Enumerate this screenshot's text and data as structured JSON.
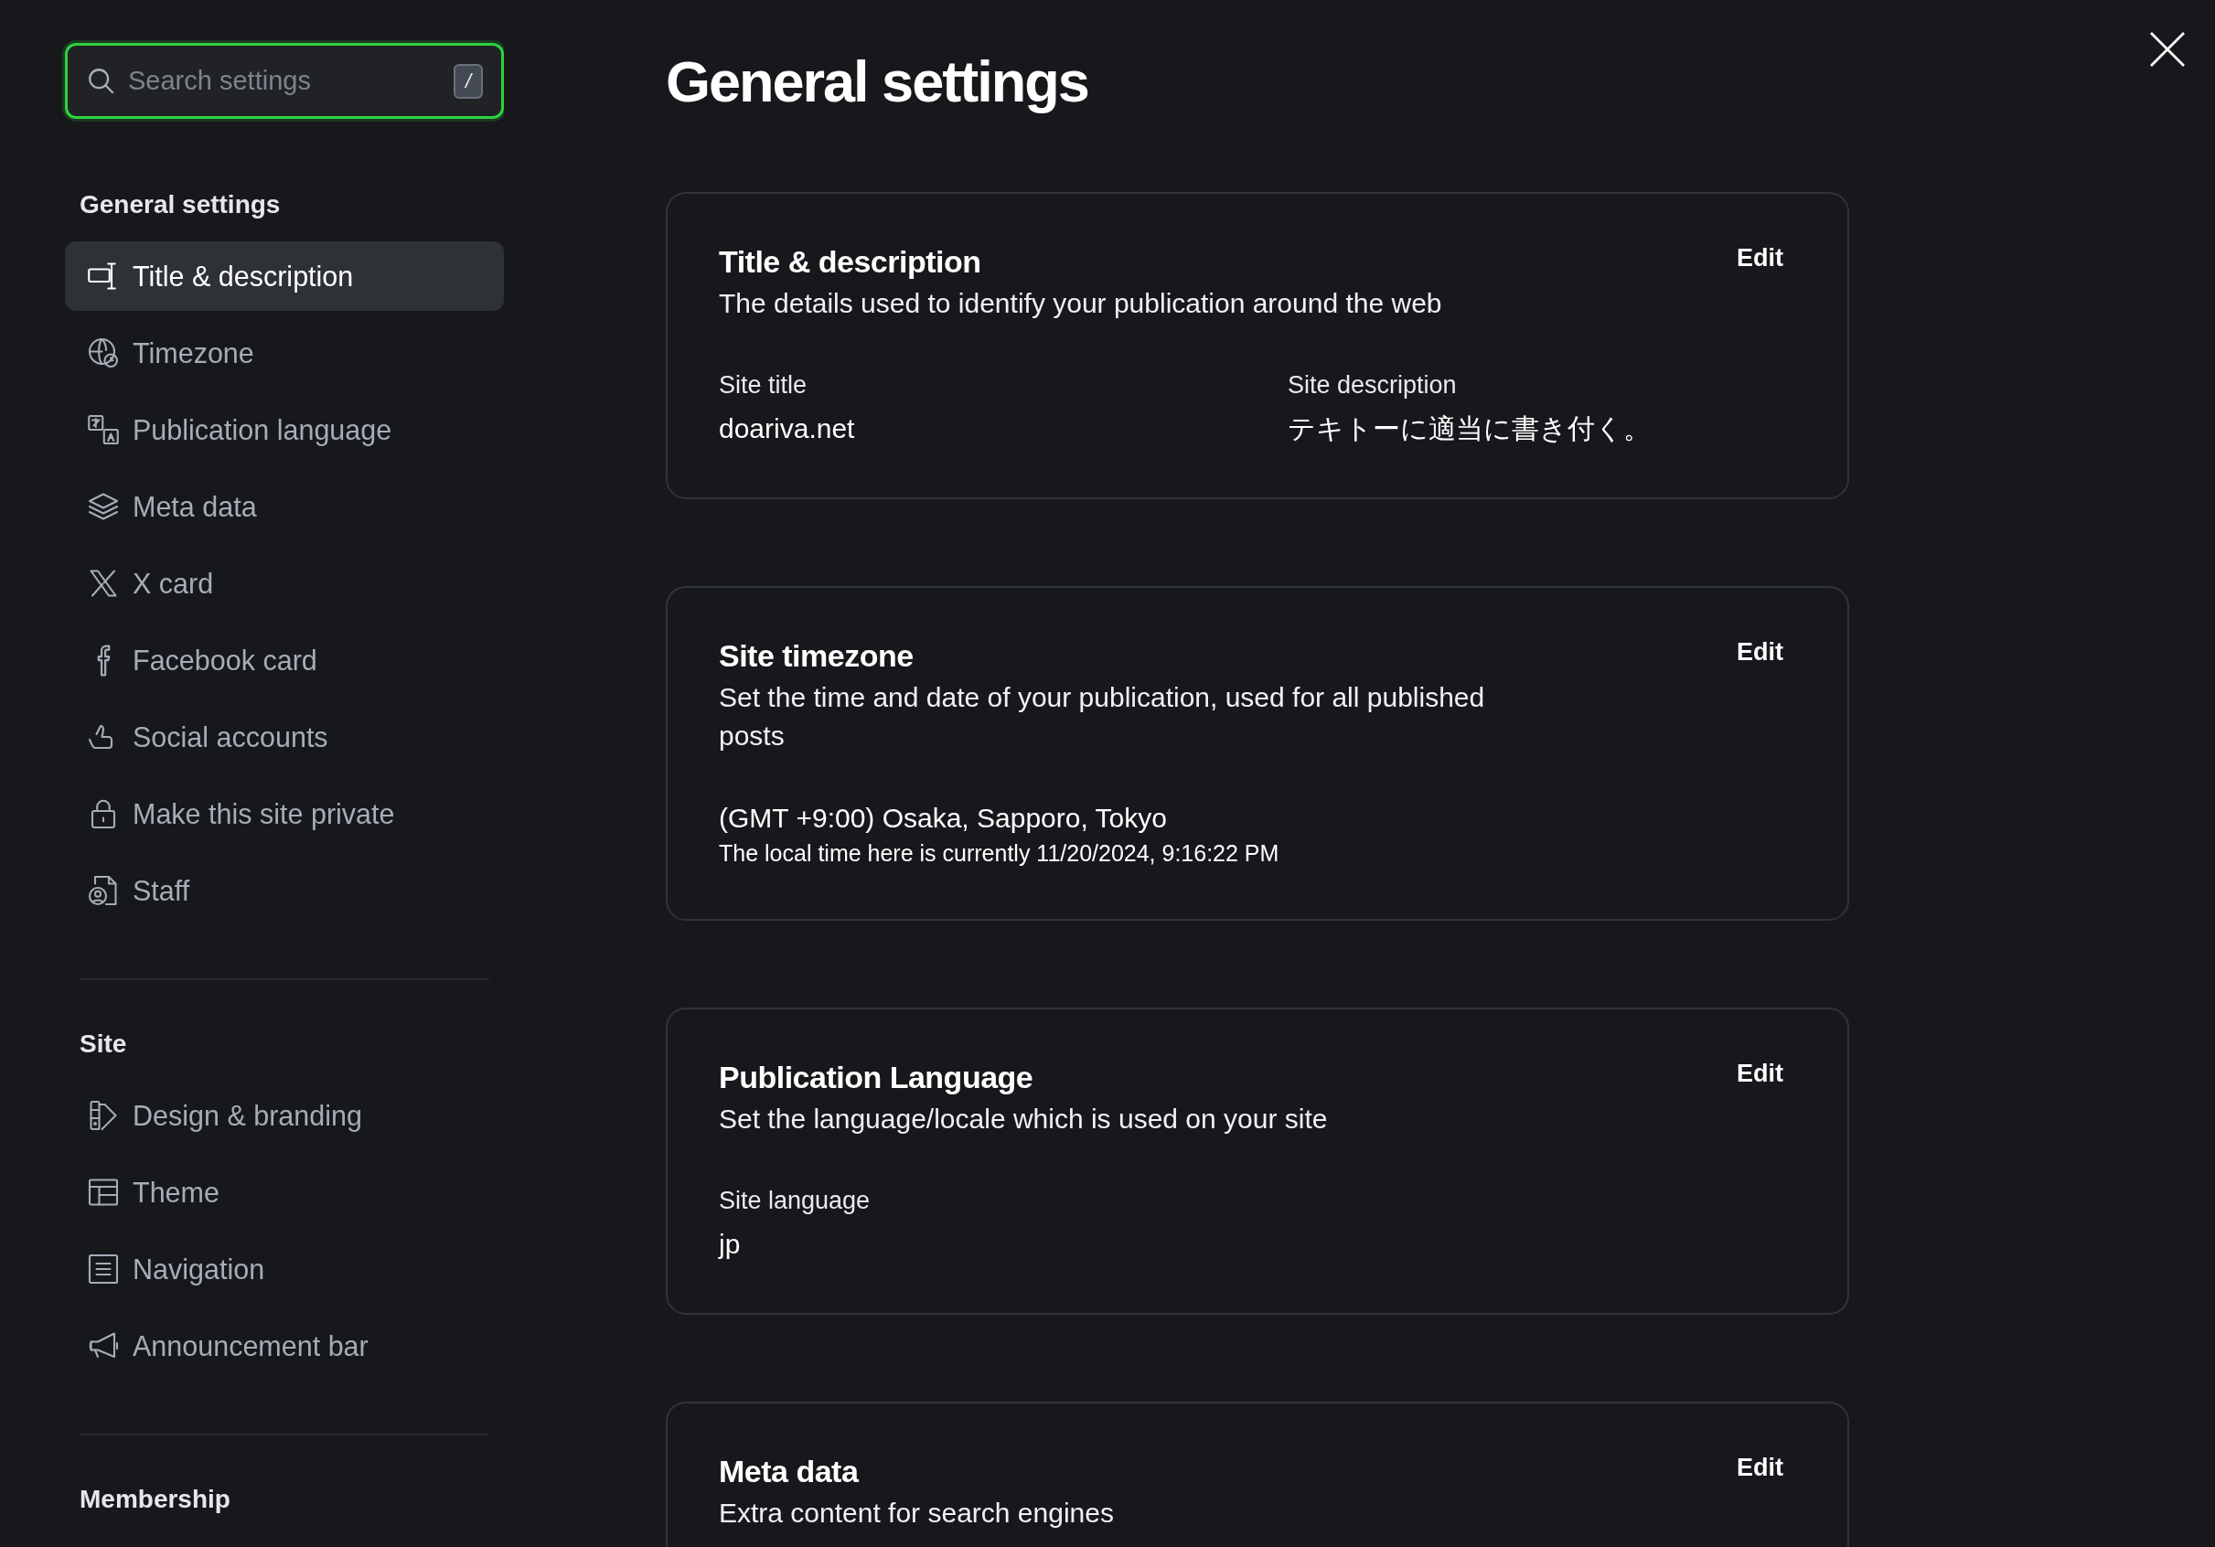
{
  "search": {
    "placeholder": "Search settings",
    "shortcut": "/",
    "focused": true
  },
  "sidebar": {
    "sections": [
      {
        "title": "General settings",
        "items": [
          {
            "label": "Title & description",
            "selected": true
          },
          {
            "label": "Timezone",
            "selected": false
          },
          {
            "label": "Publication language",
            "selected": false
          },
          {
            "label": "Meta data",
            "selected": false
          },
          {
            "label": "X card",
            "selected": false
          },
          {
            "label": "Facebook card",
            "selected": false
          },
          {
            "label": "Social accounts",
            "selected": false
          },
          {
            "label": "Make this site private",
            "selected": false
          },
          {
            "label": "Staff",
            "selected": false
          }
        ]
      },
      {
        "title": "Site",
        "items": [
          {
            "label": "Design & branding",
            "selected": false
          },
          {
            "label": "Theme",
            "selected": false
          },
          {
            "label": "Navigation",
            "selected": false
          },
          {
            "label": "Announcement bar",
            "selected": false
          }
        ]
      },
      {
        "title": "Membership"
      }
    ]
  },
  "page_title": "General settings",
  "cards": [
    {
      "title": "Title & description",
      "description": "The details used to identify your publication around the web",
      "action": "Edit",
      "fields": [
        {
          "label": "Site title",
          "value": "doariva.net"
        },
        {
          "label": "Site description",
          "value": "テキトーに適当に書き付く。"
        }
      ]
    },
    {
      "title": "Site timezone",
      "description": "Set the time and date of your publication, used for all published posts",
      "action": "Edit",
      "value": "(GMT +9:00) Osaka, Sapporo, Tokyo",
      "note": "The local time here is currently 11/20/2024, 9:16:22 PM"
    },
    {
      "title": "Publication Language",
      "description": "Set the language/locale which is used on your site",
      "action": "Edit",
      "fields": [
        {
          "label": "Site language",
          "value": "jp"
        }
      ]
    },
    {
      "title": "Meta data",
      "description": "Extra content for search engines",
      "action": "Edit"
    }
  ]
}
